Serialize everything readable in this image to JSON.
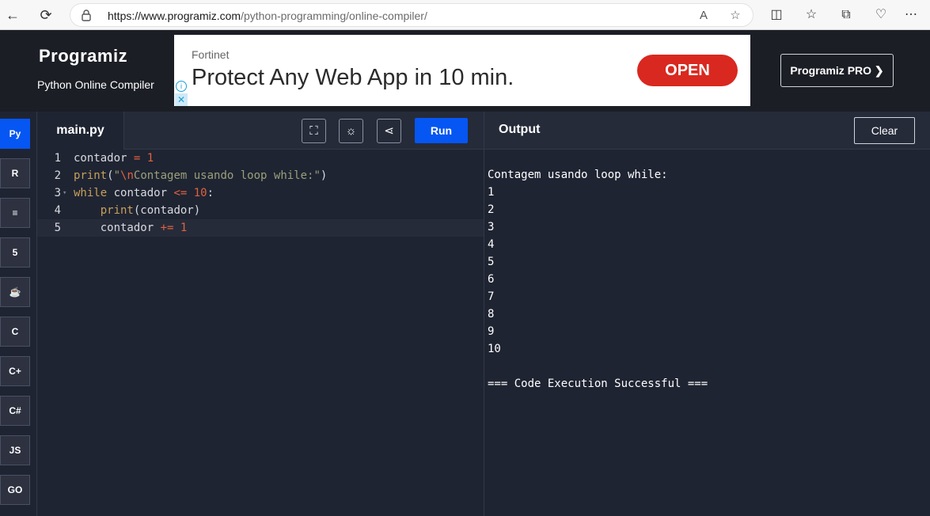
{
  "browser": {
    "url_host": "https://www.programiz.com",
    "url_path": "/python-programming/online-compiler/"
  },
  "header": {
    "logo": "Programiz",
    "subtitle": "Python Online Compiler",
    "pro_button": "Programiz PRO ❯"
  },
  "ad": {
    "brand": "Fortinet",
    "headline": "Protect Any Web App in 10 min.",
    "cta": "OPEN"
  },
  "sidebar": {
    "items": [
      {
        "name": "python",
        "label": "Py"
      },
      {
        "name": "r",
        "label": "R"
      },
      {
        "name": "sql",
        "label": "≡"
      },
      {
        "name": "html",
        "label": "5"
      },
      {
        "name": "java",
        "label": "☕"
      },
      {
        "name": "c",
        "label": "C"
      },
      {
        "name": "cpp",
        "label": "C+"
      },
      {
        "name": "csharp",
        "label": "C#"
      },
      {
        "name": "js",
        "label": "JS"
      },
      {
        "name": "go",
        "label": "GO"
      }
    ]
  },
  "editor": {
    "tab": "main.py",
    "run_label": "Run",
    "lines": [
      {
        "n": "1",
        "text": "contador = 1"
      },
      {
        "n": "2",
        "text": "print(\"\\nContagem usando loop while:\")"
      },
      {
        "n": "3",
        "text": "while contador <= 10:"
      },
      {
        "n": "4",
        "text": "    print(contador)"
      },
      {
        "n": "5",
        "text": "    contador += 1"
      }
    ]
  },
  "output": {
    "title": "Output",
    "clear_label": "Clear",
    "lines": [
      "Contagem usando loop while:",
      "1",
      "2",
      "3",
      "4",
      "5",
      "6",
      "7",
      "8",
      "9",
      "10",
      "",
      "=== Code Execution Successful ==="
    ]
  }
}
